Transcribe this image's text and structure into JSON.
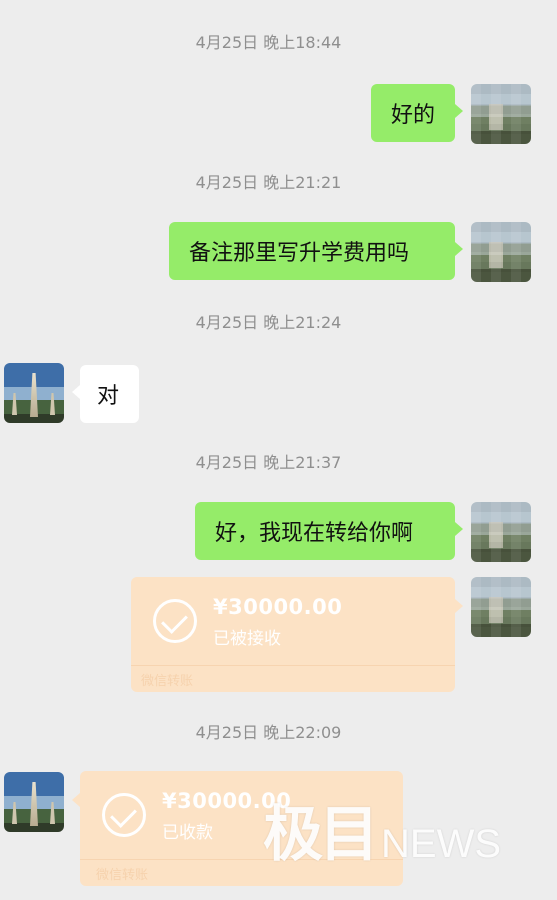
{
  "timestamps": [
    "4月25日 晚上18:44",
    "4月25日 晚上21:21",
    "4月25日 晚上21:24",
    "4月25日 晚上21:37",
    "4月25日 晚上22:09"
  ],
  "messages": {
    "m1": "好的",
    "m2": "备注那里写升学费用吗",
    "m3": "对",
    "m4": "好，我现在转给你啊"
  },
  "transfers": [
    {
      "amount": "¥30000.00",
      "status": "已被接收",
      "footer": "微信转账"
    },
    {
      "amount": "¥30000.00",
      "status": "已收款",
      "footer": "微信转账"
    }
  ],
  "watermark": {
    "cn": "极目",
    "en": "NEWS"
  },
  "colors": {
    "bubble_out": "#95ec69",
    "bubble_in": "#ffffff",
    "transfer": "#fce2c5",
    "background": "#ededed"
  }
}
